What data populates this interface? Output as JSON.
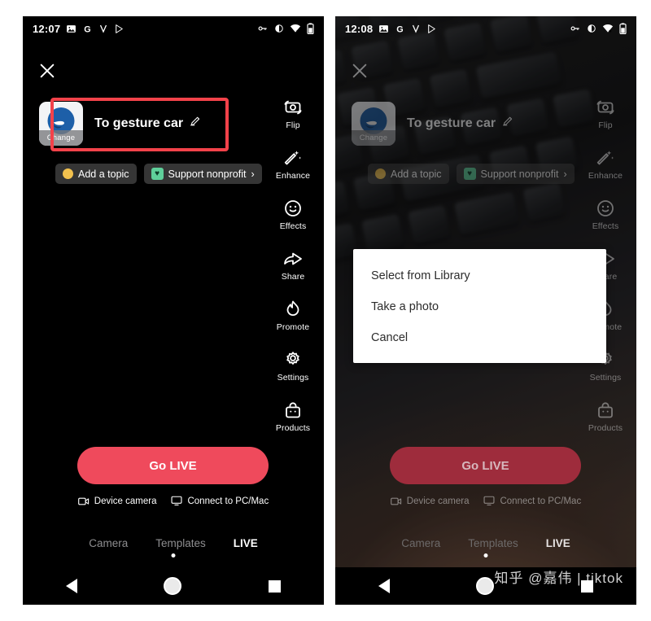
{
  "left_phone": {
    "status_bar": {
      "time": "12:07",
      "left_icons": [
        "image-icon",
        "google-g-icon",
        "v-app-icon",
        "play-store-icon"
      ],
      "right_icons": [
        "vpn-key-icon",
        "brightness-icon",
        "wifi-off-icon",
        "battery-icon"
      ]
    },
    "close_label": "Close",
    "stream": {
      "thumbnail_change_label": "Change",
      "title": "To gesture car",
      "edit_icon": "pencil-icon"
    },
    "chips": [
      {
        "label": "Add a topic",
        "icon": "yellow-circle-icon",
        "chevron": ""
      },
      {
        "label": "Support nonprofit",
        "icon": "nonprofit-icon",
        "chevron": "›"
      }
    ],
    "rail": [
      {
        "label": "Flip",
        "icon": "flip-camera-icon"
      },
      {
        "label": "Enhance",
        "icon": "magic-wand-icon"
      },
      {
        "label": "Effects",
        "icon": "smiley-face-icon"
      },
      {
        "label": "Share",
        "icon": "share-arrow-icon"
      },
      {
        "label": "Promote",
        "icon": "flame-icon"
      },
      {
        "label": "Settings",
        "icon": "gear-icon"
      },
      {
        "label": "Products",
        "icon": "shopping-bag-icon"
      }
    ],
    "go_live_label": "Go LIVE",
    "sources": [
      {
        "label": "Device camera",
        "icon": "device-camera-icon"
      },
      {
        "label": "Connect to PC/Mac",
        "icon": "monitor-icon"
      }
    ],
    "tabs": [
      {
        "label": "Camera",
        "active": false
      },
      {
        "label": "Templates",
        "active": false
      },
      {
        "label": "LIVE",
        "active": true
      }
    ],
    "nav_bar": [
      "back-icon",
      "home-icon",
      "recents-icon"
    ],
    "annotation": {
      "color": "#f3424a",
      "target": "stream-title-row"
    }
  },
  "right_phone": {
    "status_bar": {
      "time": "12:08",
      "left_icons": [
        "image-icon",
        "google-g-icon",
        "v-app-icon",
        "play-store-icon"
      ],
      "right_icons": [
        "vpn-key-icon",
        "brightness-icon",
        "wifi-off-icon",
        "battery-icon"
      ]
    },
    "close_label": "Close",
    "stream": {
      "thumbnail_change_label": "Change",
      "title": "To gesture car",
      "edit_icon": "pencil-icon"
    },
    "chips": [
      {
        "label": "Add a topic",
        "icon": "yellow-circle-icon",
        "chevron": ""
      },
      {
        "label": "Support nonprofit",
        "icon": "nonprofit-icon",
        "chevron": "›"
      }
    ],
    "rail": [
      {
        "label": "Flip",
        "icon": "flip-camera-icon"
      },
      {
        "label": "Enhance",
        "icon": "magic-wand-icon"
      },
      {
        "label": "Effects",
        "icon": "smiley-face-icon"
      },
      {
        "label": "Share",
        "icon": "share-arrow-icon"
      },
      {
        "label": "Promote",
        "icon": "flame-icon"
      },
      {
        "label": "Settings",
        "icon": "gear-icon"
      },
      {
        "label": "Products",
        "icon": "shopping-bag-icon"
      }
    ],
    "go_live_label": "Go LIVE",
    "sources": [
      {
        "label": "Device camera",
        "icon": "device-camera-icon"
      },
      {
        "label": "Connect to PC/Mac",
        "icon": "monitor-icon"
      }
    ],
    "tabs": [
      {
        "label": "Camera",
        "active": false
      },
      {
        "label": "Templates",
        "active": false
      },
      {
        "label": "LIVE",
        "active": true
      }
    ],
    "nav_bar": [
      "back-icon",
      "home-icon",
      "recents-icon"
    ],
    "dialog": {
      "options": [
        {
          "label": "Select from Library"
        },
        {
          "label": "Take a photo"
        },
        {
          "label": "Cancel"
        }
      ]
    }
  },
  "watermark": "知乎 @嘉伟 | tiktok",
  "colors": {
    "go_live": "#ef4a5c",
    "annotation": "#f3424a",
    "chip_bg": "#3a3a3a",
    "nonprofit_badge": "#5fcf9a",
    "topic_dot": "#f2c14e"
  }
}
